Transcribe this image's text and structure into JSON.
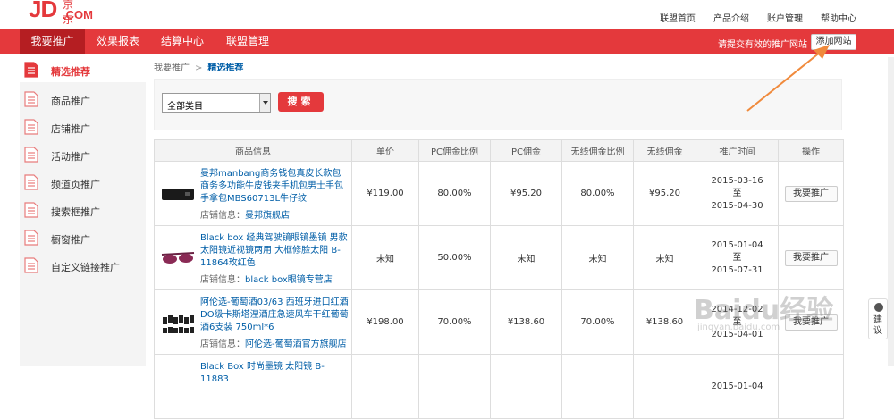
{
  "logo": {
    "main": "JD",
    "sub": ".COM",
    "cn": "京东"
  },
  "top_links": [
    "联盟首页",
    "产品介绍",
    "账户管理",
    "帮助中心"
  ],
  "nav": {
    "tabs": [
      "我要推广",
      "效果报表",
      "结算中心",
      "联盟管理"
    ],
    "hint": "请提交有效的推广网站",
    "add_site": "添加网站"
  },
  "sidebar": {
    "items": [
      "精选推荐",
      "商品推广",
      "店铺推广",
      "活动推广",
      "频道页推广",
      "搜索框推广",
      "橱窗推广",
      "自定义链接推广"
    ]
  },
  "breadcrumb": {
    "root": "我要推广",
    "sep": ">",
    "current": "精选推荐"
  },
  "filter": {
    "category": "全部类目",
    "search": "搜索"
  },
  "table": {
    "headers": [
      "商品信息",
      "单价",
      "PC佣金比例",
      "PC佣金",
      "无线佣金比例",
      "无线佣金",
      "推广时间",
      "操作"
    ],
    "rows": [
      {
        "title": "曼邦manbang商务钱包真皮长款包商务多功能牛皮钱夹手机包男士手包手拿包MBS60713L牛仔纹",
        "shop_label": "店铺信息：",
        "shop": "曼邦旗舰店",
        "price": "¥119.00",
        "pc_rate": "80.00%",
        "pc_comm": "¥95.20",
        "m_rate": "80.00%",
        "m_comm": "¥95.20",
        "start": "2015-03-16",
        "to": "至",
        "end": "2015-04-30",
        "action": "我要推广"
      },
      {
        "title": "Black box 经典驾驶镜眼镜墨镜 男款太阳镜近视镜两用 大框修脸太阳 B-11864玫红色",
        "shop_label": "店铺信息：",
        "shop": "black box眼镜专营店",
        "price": "未知",
        "pc_rate": "50.00%",
        "pc_comm": "未知",
        "m_rate": "未知",
        "m_comm": "未知",
        "start": "2015-01-04",
        "to": "至",
        "end": "2015-07-31",
        "action": "我要推广"
      },
      {
        "title": "阿伦选-葡萄酒03/63 西班牙进口红酒DO级卡斯塔涅酒庄急速风车干红葡萄酒6支装 750ml*6",
        "shop_label": "店铺信息：",
        "shop": "阿伦选-葡萄酒官方旗舰店",
        "price": "¥198.00",
        "pc_rate": "70.00%",
        "pc_comm": "¥138.60",
        "m_rate": "70.00%",
        "m_comm": "¥138.60",
        "start": "2014-12-02",
        "to": "至",
        "end": "2015-04-01",
        "action": "我要推广"
      },
      {
        "title": "Black Box 时尚墨镜 太阳镜 B-11883",
        "shop_label": "",
        "shop": "",
        "price": "",
        "pc_rate": "",
        "pc_comm": "",
        "m_rate": "",
        "m_comm": "",
        "start": "2015-01-04",
        "to": "",
        "end": "",
        "action": ""
      }
    ]
  },
  "feedback": "建议",
  "watermark": {
    "main": "Baidu经验",
    "sub": "jingyan.baidu.com"
  },
  "colors": {
    "brand": "#e4393c",
    "link": "#005ea7",
    "nav_active": "#b51e22",
    "arrow": "#f08a3c"
  }
}
